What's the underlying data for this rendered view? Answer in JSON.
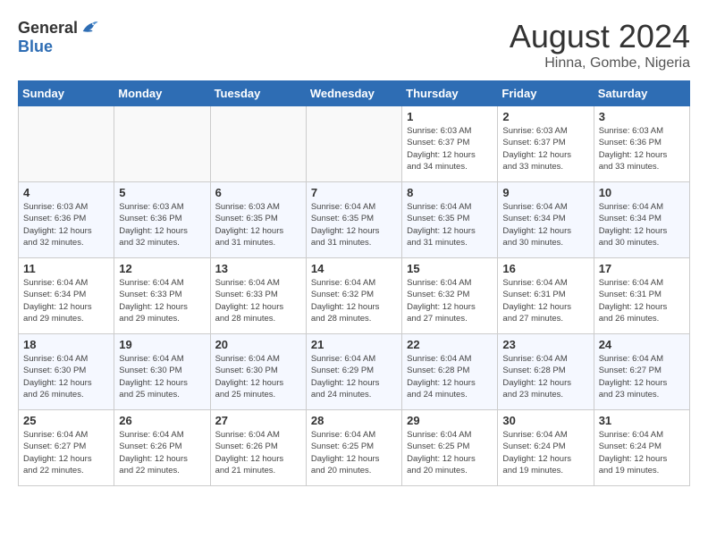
{
  "header": {
    "logo_general": "General",
    "logo_blue": "Blue",
    "month_title": "August 2024",
    "location": "Hinna, Gombe, Nigeria"
  },
  "weekdays": [
    "Sunday",
    "Monday",
    "Tuesday",
    "Wednesday",
    "Thursday",
    "Friday",
    "Saturday"
  ],
  "weeks": [
    [
      {
        "day": "",
        "info": ""
      },
      {
        "day": "",
        "info": ""
      },
      {
        "day": "",
        "info": ""
      },
      {
        "day": "",
        "info": ""
      },
      {
        "day": "1",
        "info": "Sunrise: 6:03 AM\nSunset: 6:37 PM\nDaylight: 12 hours\nand 34 minutes."
      },
      {
        "day": "2",
        "info": "Sunrise: 6:03 AM\nSunset: 6:37 PM\nDaylight: 12 hours\nand 33 minutes."
      },
      {
        "day": "3",
        "info": "Sunrise: 6:03 AM\nSunset: 6:36 PM\nDaylight: 12 hours\nand 33 minutes."
      }
    ],
    [
      {
        "day": "4",
        "info": "Sunrise: 6:03 AM\nSunset: 6:36 PM\nDaylight: 12 hours\nand 32 minutes."
      },
      {
        "day": "5",
        "info": "Sunrise: 6:03 AM\nSunset: 6:36 PM\nDaylight: 12 hours\nand 32 minutes."
      },
      {
        "day": "6",
        "info": "Sunrise: 6:03 AM\nSunset: 6:35 PM\nDaylight: 12 hours\nand 31 minutes."
      },
      {
        "day": "7",
        "info": "Sunrise: 6:04 AM\nSunset: 6:35 PM\nDaylight: 12 hours\nand 31 minutes."
      },
      {
        "day": "8",
        "info": "Sunrise: 6:04 AM\nSunset: 6:35 PM\nDaylight: 12 hours\nand 31 minutes."
      },
      {
        "day": "9",
        "info": "Sunrise: 6:04 AM\nSunset: 6:34 PM\nDaylight: 12 hours\nand 30 minutes."
      },
      {
        "day": "10",
        "info": "Sunrise: 6:04 AM\nSunset: 6:34 PM\nDaylight: 12 hours\nand 30 minutes."
      }
    ],
    [
      {
        "day": "11",
        "info": "Sunrise: 6:04 AM\nSunset: 6:34 PM\nDaylight: 12 hours\nand 29 minutes."
      },
      {
        "day": "12",
        "info": "Sunrise: 6:04 AM\nSunset: 6:33 PM\nDaylight: 12 hours\nand 29 minutes."
      },
      {
        "day": "13",
        "info": "Sunrise: 6:04 AM\nSunset: 6:33 PM\nDaylight: 12 hours\nand 28 minutes."
      },
      {
        "day": "14",
        "info": "Sunrise: 6:04 AM\nSunset: 6:32 PM\nDaylight: 12 hours\nand 28 minutes."
      },
      {
        "day": "15",
        "info": "Sunrise: 6:04 AM\nSunset: 6:32 PM\nDaylight: 12 hours\nand 27 minutes."
      },
      {
        "day": "16",
        "info": "Sunrise: 6:04 AM\nSunset: 6:31 PM\nDaylight: 12 hours\nand 27 minutes."
      },
      {
        "day": "17",
        "info": "Sunrise: 6:04 AM\nSunset: 6:31 PM\nDaylight: 12 hours\nand 26 minutes."
      }
    ],
    [
      {
        "day": "18",
        "info": "Sunrise: 6:04 AM\nSunset: 6:30 PM\nDaylight: 12 hours\nand 26 minutes."
      },
      {
        "day": "19",
        "info": "Sunrise: 6:04 AM\nSunset: 6:30 PM\nDaylight: 12 hours\nand 25 minutes."
      },
      {
        "day": "20",
        "info": "Sunrise: 6:04 AM\nSunset: 6:30 PM\nDaylight: 12 hours\nand 25 minutes."
      },
      {
        "day": "21",
        "info": "Sunrise: 6:04 AM\nSunset: 6:29 PM\nDaylight: 12 hours\nand 24 minutes."
      },
      {
        "day": "22",
        "info": "Sunrise: 6:04 AM\nSunset: 6:28 PM\nDaylight: 12 hours\nand 24 minutes."
      },
      {
        "day": "23",
        "info": "Sunrise: 6:04 AM\nSunset: 6:28 PM\nDaylight: 12 hours\nand 23 minutes."
      },
      {
        "day": "24",
        "info": "Sunrise: 6:04 AM\nSunset: 6:27 PM\nDaylight: 12 hours\nand 23 minutes."
      }
    ],
    [
      {
        "day": "25",
        "info": "Sunrise: 6:04 AM\nSunset: 6:27 PM\nDaylight: 12 hours\nand 22 minutes."
      },
      {
        "day": "26",
        "info": "Sunrise: 6:04 AM\nSunset: 6:26 PM\nDaylight: 12 hours\nand 22 minutes."
      },
      {
        "day": "27",
        "info": "Sunrise: 6:04 AM\nSunset: 6:26 PM\nDaylight: 12 hours\nand 21 minutes."
      },
      {
        "day": "28",
        "info": "Sunrise: 6:04 AM\nSunset: 6:25 PM\nDaylight: 12 hours\nand 20 minutes."
      },
      {
        "day": "29",
        "info": "Sunrise: 6:04 AM\nSunset: 6:25 PM\nDaylight: 12 hours\nand 20 minutes."
      },
      {
        "day": "30",
        "info": "Sunrise: 6:04 AM\nSunset: 6:24 PM\nDaylight: 12 hours\nand 19 minutes."
      },
      {
        "day": "31",
        "info": "Sunrise: 6:04 AM\nSunset: 6:24 PM\nDaylight: 12 hours\nand 19 minutes."
      }
    ]
  ]
}
